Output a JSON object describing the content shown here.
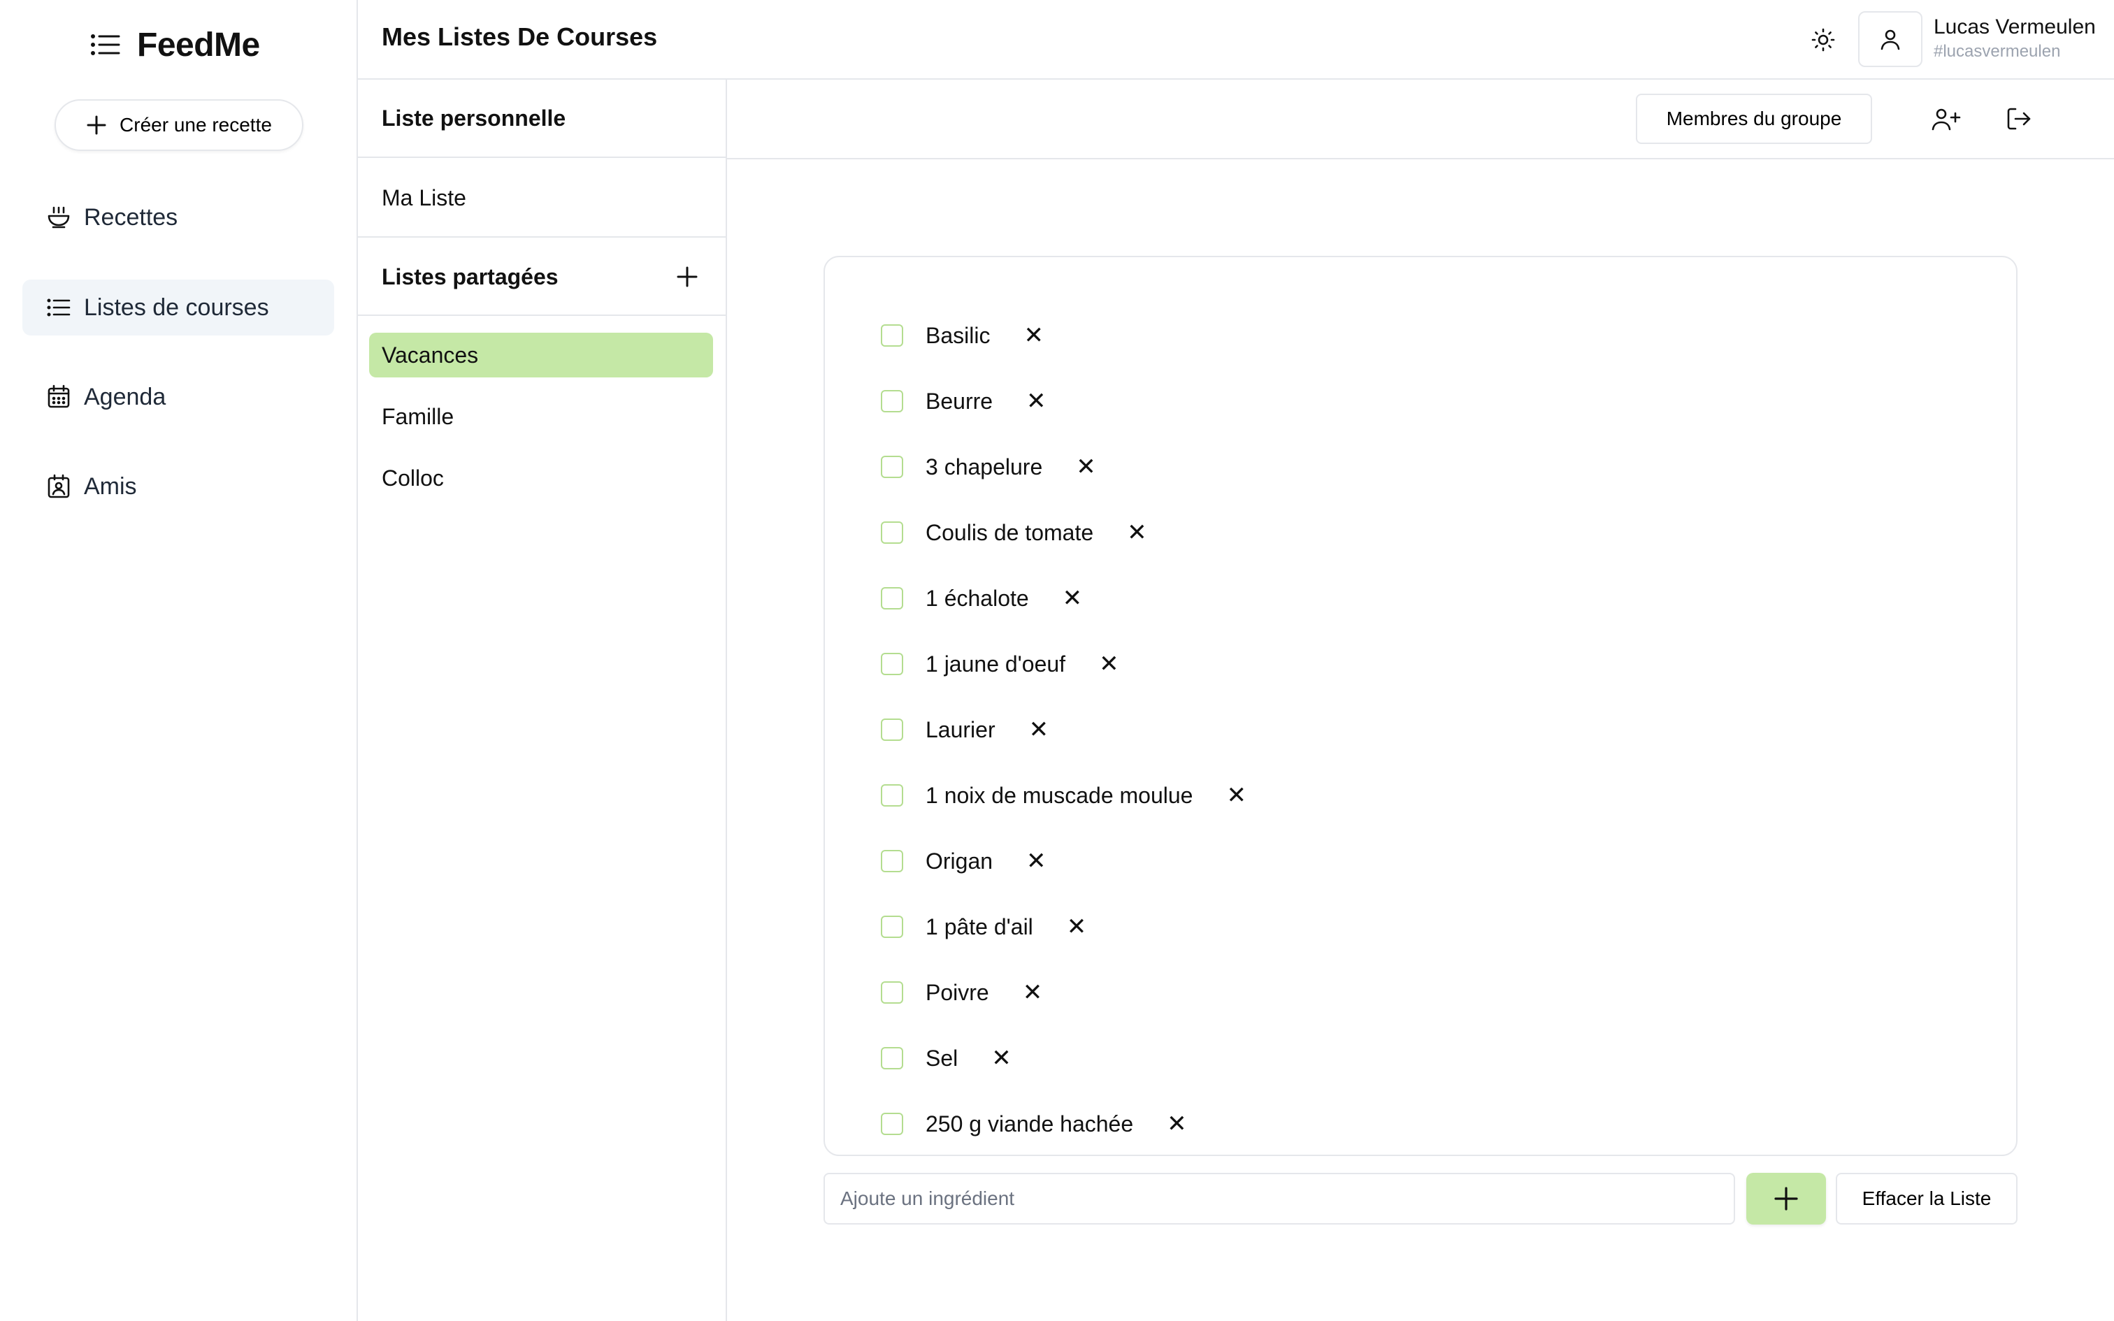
{
  "app": {
    "name": "FeedMe"
  },
  "sidebar": {
    "create_label": "Créer une recette",
    "items": [
      {
        "label": "Recettes",
        "icon": "bowl-icon"
      },
      {
        "label": "Listes de courses",
        "icon": "list-icon",
        "active": true
      },
      {
        "label": "Agenda",
        "icon": "calendar-icon"
      },
      {
        "label": "Amis",
        "icon": "contact-icon"
      }
    ]
  },
  "header": {
    "title": "Mes Listes De Courses",
    "user": {
      "name": "Lucas Vermeulen",
      "handle": "#lucasvermeulen"
    }
  },
  "lists": {
    "personal_title": "Liste personnelle",
    "personal_items": [
      "Ma Liste"
    ],
    "shared_title": "Listes partagées",
    "shared_items": [
      "Vacances",
      "Famille",
      "Colloc"
    ],
    "active_shared": "Vacances"
  },
  "toolbar": {
    "members_label": "Membres du groupe"
  },
  "shopping_list": {
    "items": [
      "Basilic",
      "Beurre",
      "3 chapelure",
      "Coulis de tomate",
      "1 échalote",
      "1 jaune d'oeuf",
      "Laurier",
      "1 noix de muscade moulue",
      "Origan",
      "1 pâte d'ail",
      "Poivre",
      "Sel",
      "250 g viande hachée"
    ],
    "remove_glyph": "✕"
  },
  "input": {
    "placeholder": "Ajoute un ingrédient",
    "value": ""
  },
  "actions": {
    "clear_label": "Effacer la Liste"
  },
  "colors": {
    "accent": "#c5e8a6",
    "checkbox_border": "#b4dd90",
    "active_nav_bg": "#f1f5f9",
    "border": "#e5e7eb"
  }
}
